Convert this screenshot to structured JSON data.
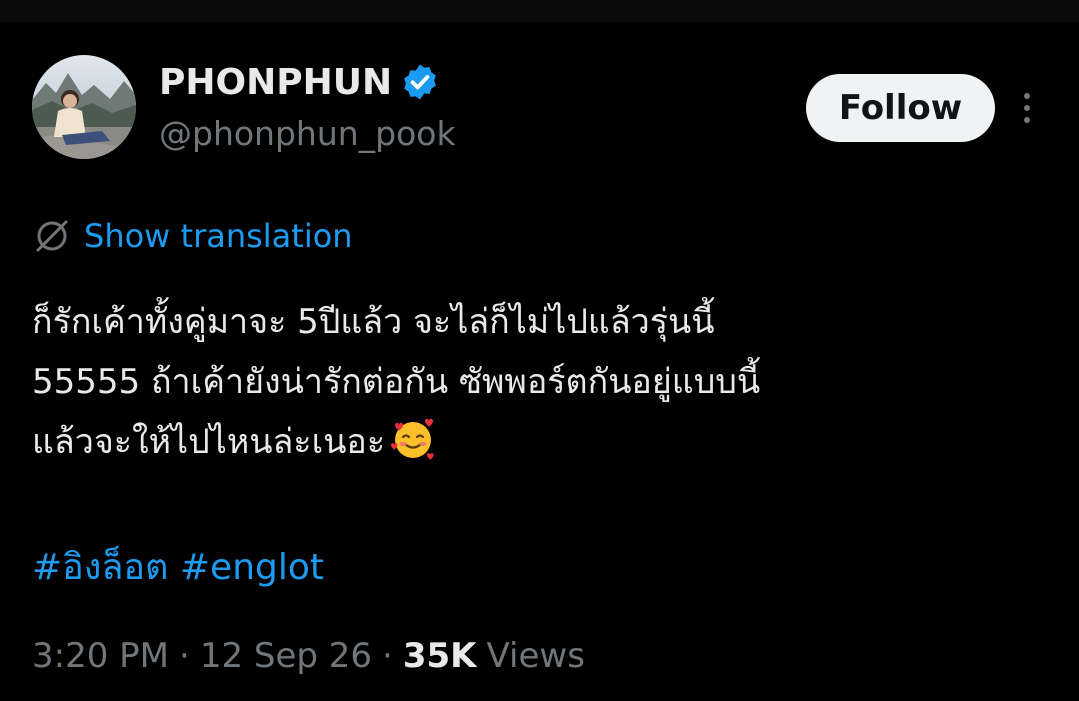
{
  "author": {
    "display_name": "PHONPHUN",
    "handle": "@phonphun_pook",
    "verified": true,
    "avatar_icon": "user-avatar-photo"
  },
  "actions": {
    "follow_label": "Follow",
    "more_icon": "more-vertical-icon"
  },
  "translation": {
    "label": "Show translation",
    "icon": "globe-slash-icon"
  },
  "tweet": {
    "lines": [
      "ก็รักเค้าทั้งคู่มาจะ 5ปีแล้ว จะไล่ก็ไม่ไปแล้วรุ่นนี้",
      "55555 ถ้าเค้ายังน่ารักต่อกัน ซัพพอร์ตกันอยู่แบบนี้",
      "แล้วจะให้ไปไหนล่ะเนอะ"
    ],
    "emoji": "smiling-face-with-hearts-icon",
    "hashtags": [
      "#อิงล็อต",
      "#englot"
    ]
  },
  "meta": {
    "time": "3:20 PM",
    "date": "12 Sep 26",
    "separator": "·",
    "views_count": "35K",
    "views_label": "Views"
  },
  "colors": {
    "background": "#000000",
    "text": "#e7e9ea",
    "secondary": "#71767b",
    "accent": "#1d9bf0",
    "follow_bg": "#eff3f4"
  }
}
